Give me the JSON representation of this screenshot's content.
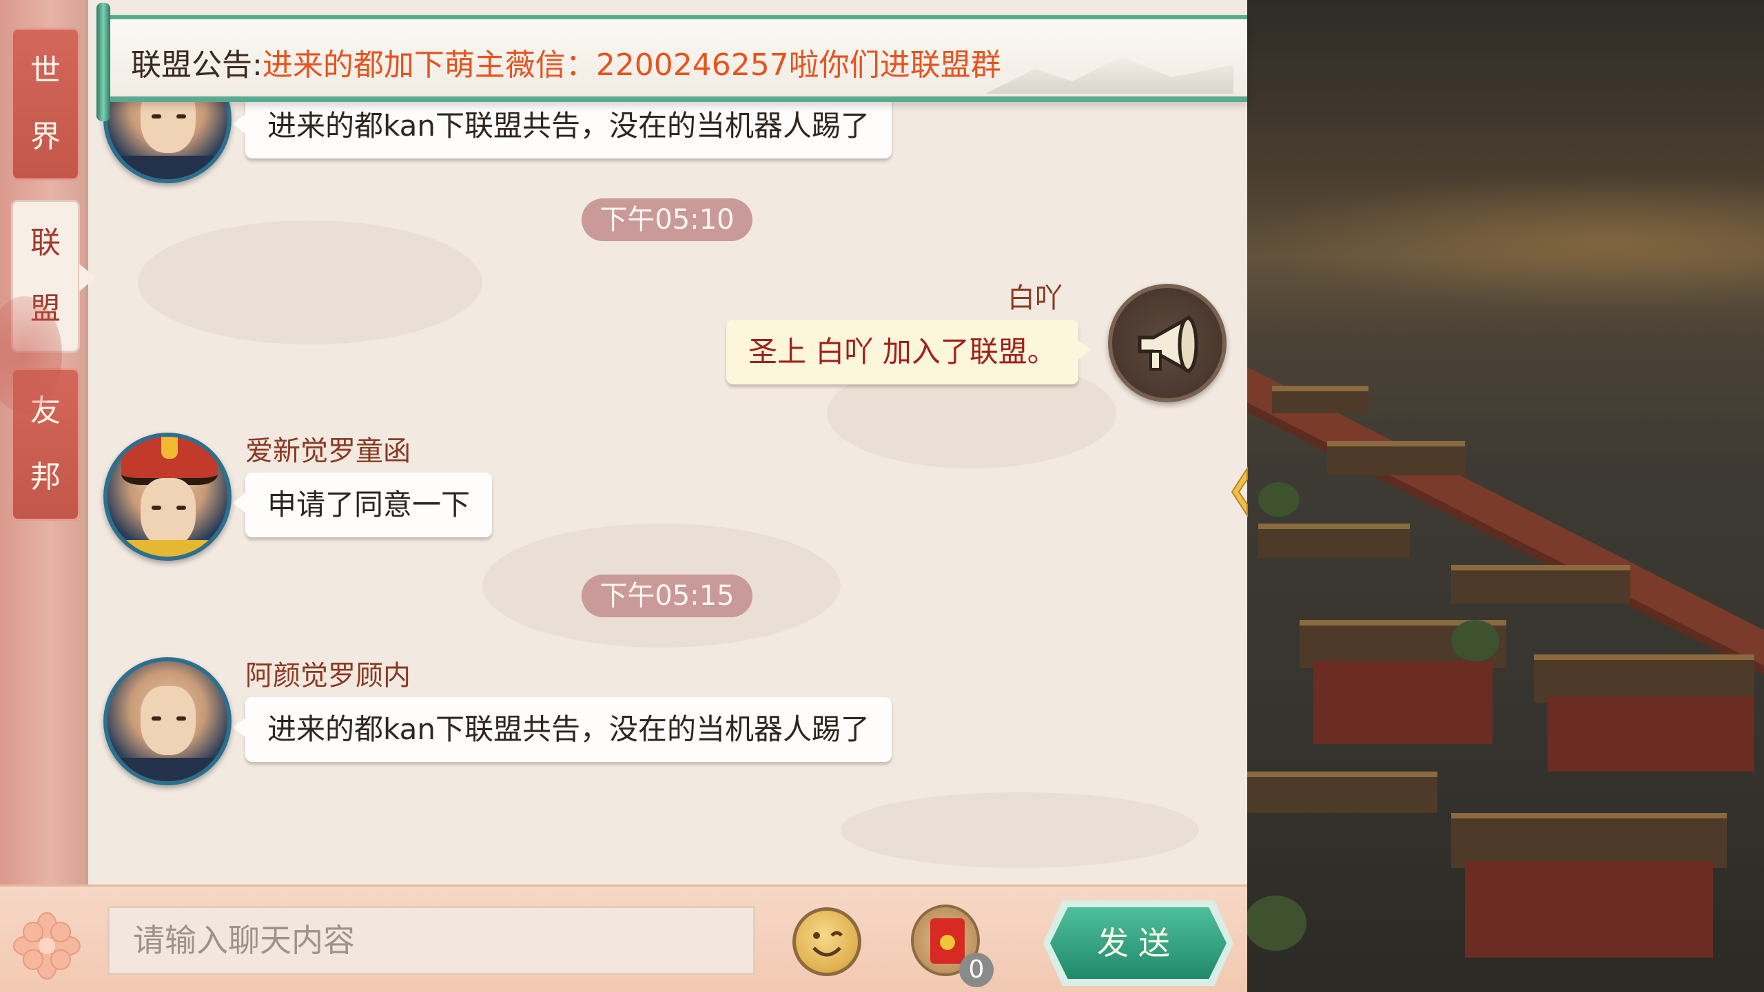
{
  "tabs": [
    {
      "label_1": "世",
      "label_2": "界"
    },
    {
      "label_1": "联",
      "label_2": "盟"
    },
    {
      "label_1": "友",
      "label_2": "邦"
    }
  ],
  "announcement": {
    "prefix": "联盟公告:",
    "text": "进来的都加下萌主薇信：2200246257啦你们进联盟群"
  },
  "messages": [
    {
      "text": "进来的都kan下联盟共告，没在的当机器人踢了"
    },
    {
      "time": "下午05:10"
    },
    {
      "name": "白吖",
      "text": "圣上 白吖 加入了联盟。"
    },
    {
      "name": "爱新觉罗童函",
      "text": "申请了同意一下"
    },
    {
      "time": "下午05:15"
    },
    {
      "name": "阿颜觉罗顾内",
      "text": "进来的都kan下联盟共告，没在的当机器人踢了"
    }
  ],
  "input": {
    "placeholder": "请输入聊天内容"
  },
  "red_packet": {
    "count": "0"
  },
  "send_label": "发送",
  "icons": {
    "emoji": "smiley-face-icon",
    "red_packet": "red-envelope-icon",
    "system": "megaphone-icon",
    "decor": "flower-icon",
    "collapse": "chevron-left-icon"
  },
  "colors": {
    "accent_green": "#5aaa90",
    "announcement_highlight": "#e6531f",
    "name_color": "#8a3a22",
    "system_text": "#a2201a"
  }
}
